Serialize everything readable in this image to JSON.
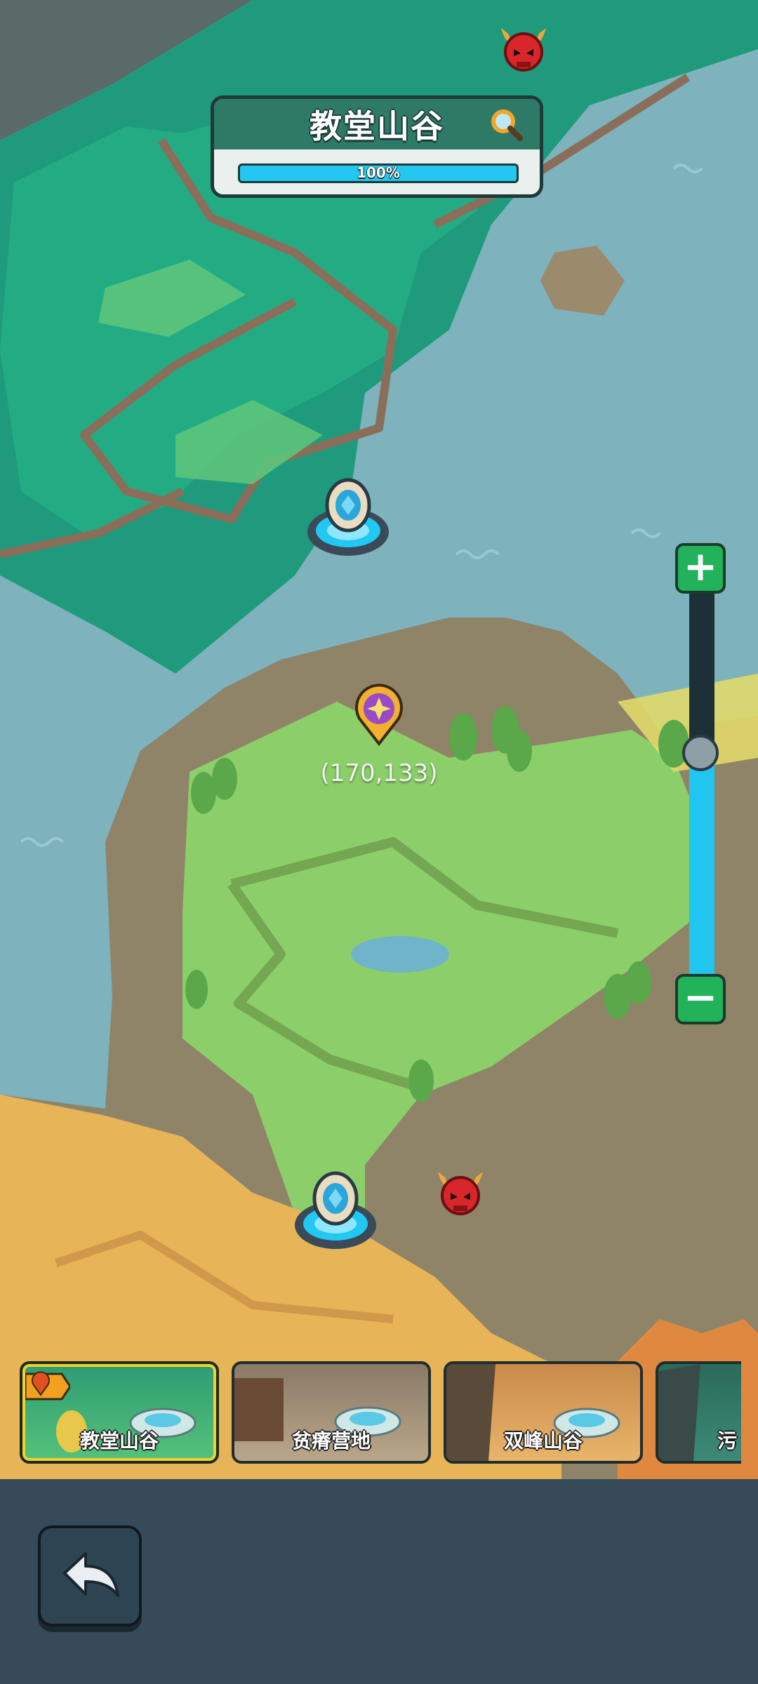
{
  "region_header": {
    "title": "教堂山谷",
    "progress_label": "100%",
    "progress": 1.0
  },
  "map": {
    "coordinates": "(170,133)"
  },
  "zoom": {
    "plus_label": "+",
    "minus_label": "−",
    "level": 0.58
  },
  "regions": [
    {
      "name": "教堂山谷",
      "active": true
    },
    {
      "name": "贫瘠营地",
      "active": false
    },
    {
      "name": "双峰山谷",
      "active": false
    },
    {
      "name": "污",
      "active": false
    }
  ],
  "colors": {
    "water": "#7eb2bc",
    "forest": "#1f9a7c",
    "grass": "#8ccf6a",
    "dirt": "#8f8468",
    "sand": "#e8b458",
    "progress": "#22c8f2",
    "zoom_button": "#22b25a",
    "active_card_border": "#f0d22a"
  },
  "icons": {
    "search": "magnifier-icon",
    "portal": "teleport-portal-icon",
    "demon": "demon-skull-icon",
    "location_pin": "location-pin-icon",
    "back": "back-arrow-icon"
  }
}
